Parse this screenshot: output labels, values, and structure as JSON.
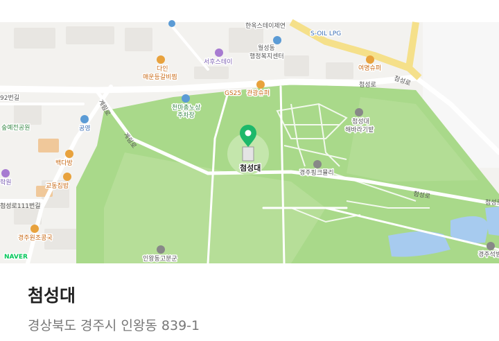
{
  "map": {
    "provider": "NAVER",
    "selected_place_label": "첨성대",
    "road_labels": [
      "첨성로",
      "첨성로",
      "첨성로111번길",
      "계림로",
      "첨성로",
      "첨성로",
      "계림로"
    ],
    "poi_labels": {
      "hanok_stay": "한옥스테이제연",
      "woldong_center_1": "월성동",
      "woldong_center_2": "행정복지센터",
      "soil_lpg": "S-OIL LPG",
      "yeomyeong": "여명슈퍼",
      "dain_1": "다인",
      "dain_2": "매운등갈비찜",
      "seohu": "서후스테이",
      "gs25": "GS25",
      "gwangwang": "관광슈퍼",
      "parking_1": "천마총노상",
      "parking_2": "주차장",
      "gongyeong": "공영",
      "jeonggong": "숲예전공원",
      "baekdabang": "백다방",
      "hakwon": "학원",
      "gyodong": "교동집밥",
      "gyeongju_won": "경주원조콩국",
      "cheomseong_hebaragi_1": "첨성대",
      "cheomseong_hebaragi_2": "해바라기밭",
      "pink_muhly": "경주핑크뮬리",
      "inwang_gobun": "인왕동고분군",
      "gyeongju_right": "경주석빙",
      "gu_label": "92번길"
    },
    "colors": {
      "park": "#a9d98a",
      "background": "#f3f2ef",
      "road_major": "#f5e08a",
      "water": "#a7cbef",
      "pin": "#1db86a"
    }
  },
  "place": {
    "title": "첨성대",
    "address": "경상북도 경주시 인왕동 839-1"
  }
}
